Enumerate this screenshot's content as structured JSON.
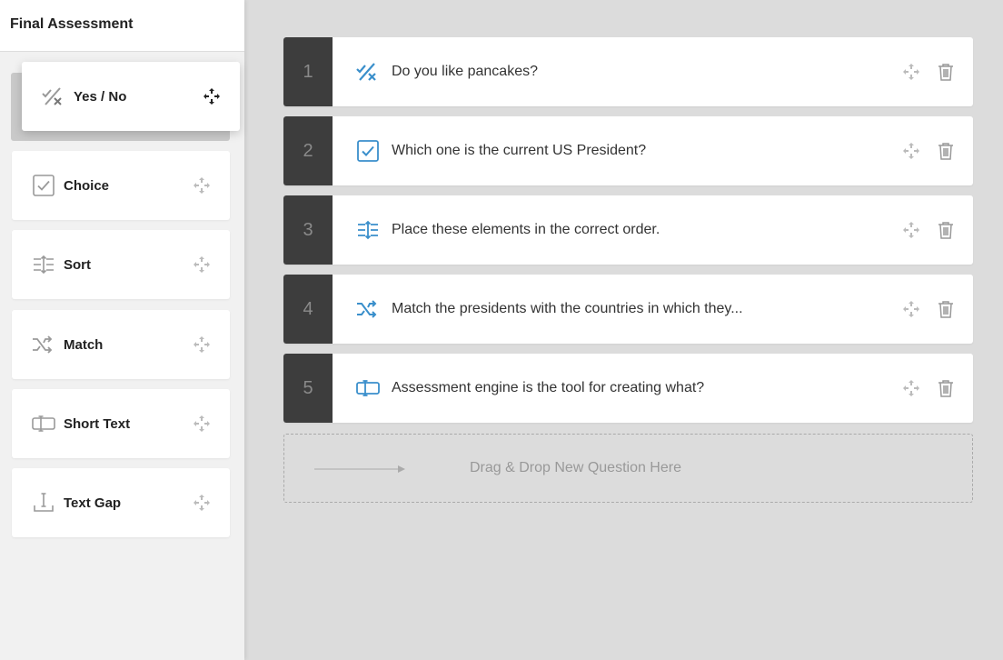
{
  "sidebar": {
    "title": "Final Assessment",
    "dragging_item": {
      "label": "Yes / No",
      "icon": "yes-no-icon"
    },
    "items": [
      {
        "label": "Choice",
        "icon": "choice-checkbox-icon"
      },
      {
        "label": "Sort",
        "icon": "sort-icon"
      },
      {
        "label": "Match",
        "icon": "match-shuffle-icon"
      },
      {
        "label": "Short Text",
        "icon": "short-text-icon"
      },
      {
        "label": "Text Gap",
        "icon": "text-gap-icon"
      }
    ]
  },
  "questions": [
    {
      "number": "1",
      "text": "Do you like pancakes?",
      "icon": "yes-no-icon"
    },
    {
      "number": "2",
      "text": "Which one is the current US President?",
      "icon": "choice-checkbox-icon"
    },
    {
      "number": "3",
      "text": "Place these elements in the correct order.",
      "icon": "sort-icon"
    },
    {
      "number": "4",
      "text": "Match the presidents with the countries in which they...",
      "icon": "match-shuffle-icon"
    },
    {
      "number": "5",
      "text": "Assessment engine is the tool for creating what?",
      "icon": "short-text-icon"
    }
  ],
  "drop_zone": {
    "text": "Drag & Drop New Question Here"
  },
  "colors": {
    "accent": "#3a8fcb",
    "number_bg": "#3d3d3d",
    "icon_gray": "#999999"
  }
}
